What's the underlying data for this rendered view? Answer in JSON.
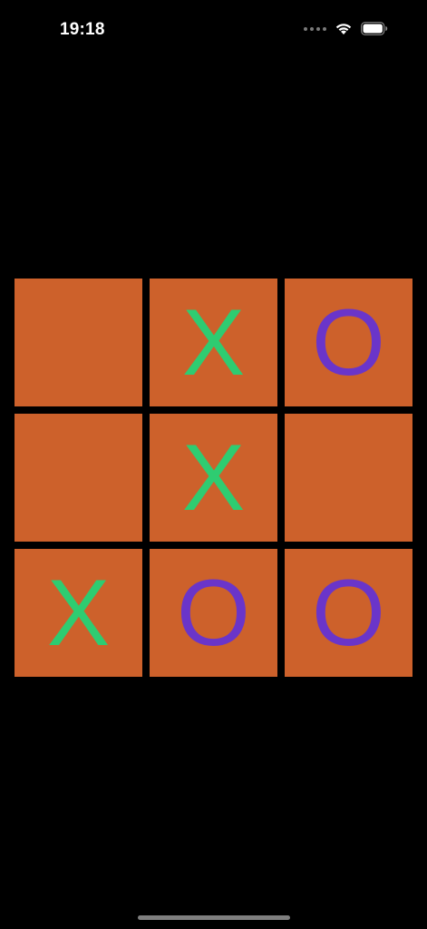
{
  "status_bar": {
    "time": "19:18",
    "signal_icon": "signal-dots-icon",
    "wifi_icon": "wifi-icon",
    "battery_icon": "battery-icon"
  },
  "colors": {
    "background": "#000000",
    "cell": "#cd612b",
    "x_mark": "#2ecc71",
    "o_mark": "#6a35c9"
  },
  "board": {
    "cells": [
      {
        "row": 1,
        "col": 1,
        "mark": ""
      },
      {
        "row": 1,
        "col": 2,
        "mark": "X"
      },
      {
        "row": 1,
        "col": 3,
        "mark": "O"
      },
      {
        "row": 2,
        "col": 1,
        "mark": ""
      },
      {
        "row": 2,
        "col": 2,
        "mark": "X"
      },
      {
        "row": 2,
        "col": 3,
        "mark": ""
      },
      {
        "row": 3,
        "col": 1,
        "mark": "X"
      },
      {
        "row": 3,
        "col": 2,
        "mark": "O"
      },
      {
        "row": 3,
        "col": 3,
        "mark": "O"
      }
    ]
  }
}
